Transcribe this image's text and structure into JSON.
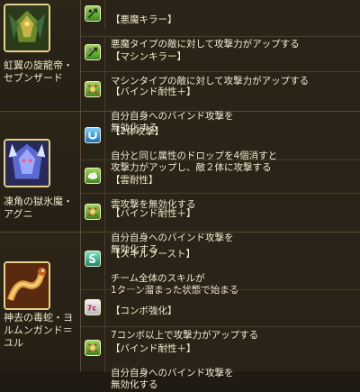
{
  "monsters": [
    {
      "name": "虹翼の旋龍帝・セブンザード",
      "awakenings": [
        {
          "icon": "devil-killer-icon",
          "title": "【悪魔キラー】",
          "desc": "悪魔タイプの敵に対して攻撃力がアップする"
        },
        {
          "icon": "machine-killer-icon",
          "title": "【マシンキラー】",
          "desc": "マシンタイプの敵に対して攻撃力がアップする"
        },
        {
          "icon": "bind-resist-icon",
          "title": "【バインド耐性＋】",
          "desc": "自分自身へのバインド攻撃を\n無効化する"
        }
      ]
    },
    {
      "name": "凍角の獄氷魔・アグニ",
      "awakenings": [
        {
          "icon": "two-way-attack-icon",
          "title": "【2体攻撃】",
          "desc": "自分と同じ属性のドロップを4個消すと\n攻撃力がアップし、敵２体に攻撃する"
        },
        {
          "icon": "cloud-resist-icon",
          "title": "【雲耐性】",
          "desc": "雲攻撃を無効化する"
        },
        {
          "icon": "bind-resist-icon",
          "title": "【バインド耐性＋】",
          "desc": "自分自身へのバインド攻撃を\n無効化する"
        }
      ]
    },
    {
      "name": "神去の毒蛇・ヨルムンガンド＝ユル",
      "awakenings": [
        {
          "icon": "skill-boost-icon",
          "title": "【スキルブースト】",
          "desc": "チーム全体のスキルが\n1ターン溜まった状態で始まる"
        },
        {
          "icon": "combo-boost-icon",
          "title": "【コンボ強化】",
          "desc": "7コンボ以上で攻撃力がアップする"
        },
        {
          "icon": "bind-resist-icon",
          "title": "【バインド耐性＋】",
          "desc": "自分自身へのバインド攻撃を\n無効化する"
        }
      ]
    }
  ]
}
